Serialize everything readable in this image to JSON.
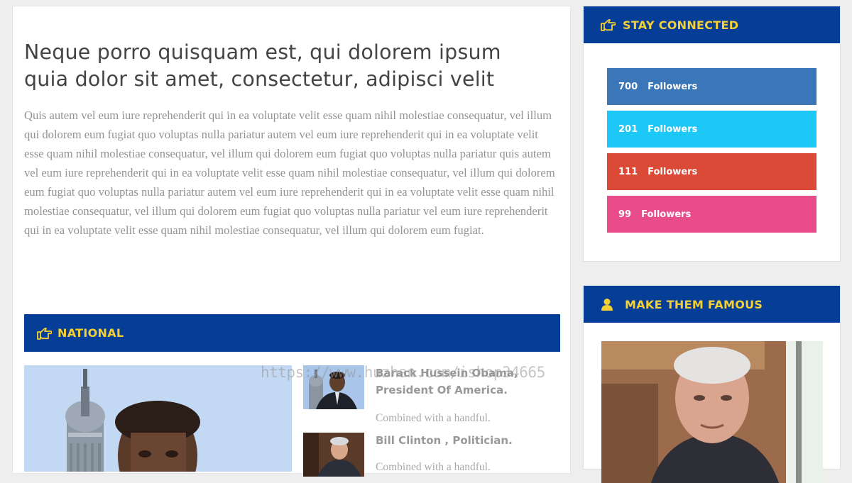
{
  "article": {
    "title": "Neque porro quisquam est, qui dolorem ipsum quia dolor sit amet, consectetur, adipisci velit",
    "body": "Quis autem vel eum iure reprehenderit qui in ea voluptate velit esse quam nihil molestiae consequatur, vel illum qui dolorem eum fugiat quo voluptas nulla pariatur autem vel eum iure reprehenderit qui in ea voluptate velit esse quam nihil molestiae consequatur, vel illum qui dolorem eum fugiat quo voluptas nulla pariatur quis autem vel eum iure reprehenderit qui in ea voluptate velit esse quam nihil molestiae consequatur, vel illum qui dolorem eum fugiat quo voluptas nulla pariatur autem vel eum iure reprehenderit qui in ea voluptate velit esse quam nihil molestiae consequatur, vel illum qui dolorem eum fugiat quo voluptas nulla pariatur vel eum iure reprehenderit qui in ea voluptate velit esse quam nihil molestiae consequatur, vel illum qui dolorem eum fugiat."
  },
  "national": {
    "title": "NATIONAL",
    "icon": "pointing-hand-icon",
    "items": [
      {
        "title": "Barack Hussein Obama, President Of America.",
        "desc": "Combined with a handful."
      },
      {
        "title": "Bill Clinton , Politician.",
        "desc": "Combined with a handful."
      }
    ]
  },
  "watermark": "https://www.huzhan.com/ishop34665",
  "stay_connected": {
    "title": "STAY CONNECTED",
    "icon": "pointing-hand-icon",
    "buttons": [
      {
        "count": "700",
        "label": "Followers",
        "color": "#3a76b8"
      },
      {
        "count": "201",
        "label": "Followers",
        "color": "#1dc8f6"
      },
      {
        "count": "111",
        "label": "Followers",
        "color": "#db4a37"
      },
      {
        "count": "99",
        "label": "Followers",
        "color": "#e94c8b"
      }
    ]
  },
  "make_famous": {
    "title": "MAKE THEM FAMOUS",
    "icon": "user-icon"
  },
  "colors": {
    "header_bar": "#063d96",
    "header_text": "#f4d035",
    "page_bg": "#efeeee"
  }
}
